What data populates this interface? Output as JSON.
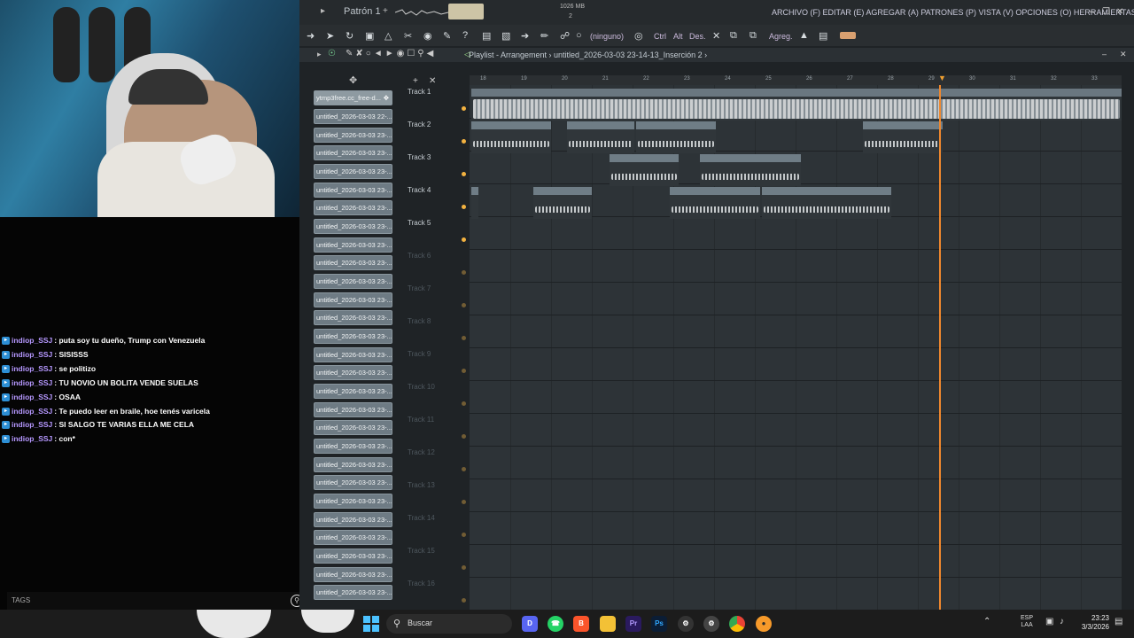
{
  "fl": {
    "pattern_label": "Patrón 1",
    "pattern_add": "+",
    "mem_value": "1026 MB",
    "mem_sub": "2",
    "menu": "ARCHIVO (F) EDITAR (E) AGREGAR (A) PATRONES (P) VISTA (V) OPCIONES (O) HERRAMIENTAS (T) AYUDA",
    "toolbar_none_label": "(ninguno)",
    "toolbar_ctrl": "Ctrl",
    "toolbar_alt": "Alt",
    "toolbar_des": "Des.",
    "toolbar_agreg": "Agreg.",
    "playlist_title": "Playlist - Arrangement › untitled_2026-03-03 23-14-13_Inserción 2 ›",
    "pattern_first": "ytmp3free.cc_free-d...",
    "pattern_items": [
      "untitled_2026-03-03 22-...",
      "untitled_2026-03-03 23-...",
      "untitled_2026-03-03 23-...",
      "untitled_2026-03-03 23-...",
      "untitled_2026-03-03 23-...",
      "untitled_2026-03-03 23-...",
      "untitled_2026-03-03 23-...",
      "untitled_2026-03-03 23-...",
      "untitled_2026-03-03 23-...",
      "untitled_2026-03-03 23-...",
      "untitled_2026-03-03 23-...",
      "untitled_2026-03-03 23-...",
      "untitled_2026-03-03 23-...",
      "untitled_2026-03-03 23-...",
      "untitled_2026-03-03 23-...",
      "untitled_2026-03-03 23-...",
      "untitled_2026-03-03 23-...",
      "untitled_2026-03-03 23-...",
      "untitled_2026-03-03 23-...",
      "untitled_2026-03-03 23-...",
      "untitled_2026-03-03 23-...",
      "untitled_2026-03-03 23-...",
      "untitled_2026-03-03 23-...",
      "untitled_2026-03-03 23-...",
      "untitled_2026-03-03 23-...",
      "untitled_2026-03-03 23-...",
      "untitled_2026-03-03 23-...",
      "untitled_2026-03-03 23-..."
    ],
    "tracks": [
      "Track 1",
      "Track 2",
      "Track 3",
      "Track 4",
      "Track 5",
      "Track 6",
      "Track 7",
      "Track 8",
      "Track 9",
      "Track 10",
      "Track 11",
      "Track 12",
      "Track 13",
      "Track 14",
      "Track 15",
      "Track 16"
    ],
    "bar_numbers": [
      "18",
      "19",
      "20",
      "21",
      "22",
      "23",
      "24",
      "25",
      "26",
      "27",
      "28",
      "29",
      "30",
      "31",
      "32",
      "33"
    ],
    "clips": {
      "t1": "ytmp3free.cc_free-detroit-type-beat-sample-2026-haiti-youtubemp3free.org",
      "t2a": "untitled_202..._Inserción 2",
      "t2b": "untitled_2...serción 2",
      "t2c": "untitled_202..._Inserción 2",
      "t2d": "untitled_202..._Inserción 2",
      "t3a": "untitled_2...nserción 2",
      "t3b": "untitled_2026-03-...-27_Inserción 2",
      "t4a": "untitled_...erción 2",
      "t4b": "untitled_2026-...27_Inserción 2",
      "t4c": "untitled_2026-03-03 23-22-09_Inserción 2"
    }
  },
  "chat": {
    "messages": [
      {
        "user": "indiop_SSJ",
        "text": ": puta soy tu dueño, Trump con Venezuela"
      },
      {
        "user": "indiop_SSJ",
        "text": ": SISISSS"
      },
      {
        "user": "indiop_SSJ",
        "text": ": se politizo"
      },
      {
        "user": "indiop_SSJ",
        "text": ": TU NOVIO UN BOLITA VENDE SUELAS"
      },
      {
        "user": "indiop_SSJ",
        "text": ": OSAA"
      },
      {
        "user": "indiop_SSJ",
        "text": ": Te puedo leer en braile, hoe tenés varicela"
      },
      {
        "user": "indiop_SSJ",
        "text": ": SI SALGO TE VARIAS ELLA ME CELA"
      },
      {
        "user": "indiop_SSJ",
        "text": ": con*"
      }
    ],
    "tags_label": "TAGS"
  },
  "taskbar": {
    "search_label": "Buscar",
    "lang": "ESP",
    "lang_sub": "LAA",
    "time": "23:23",
    "date": "3/3/2026"
  }
}
